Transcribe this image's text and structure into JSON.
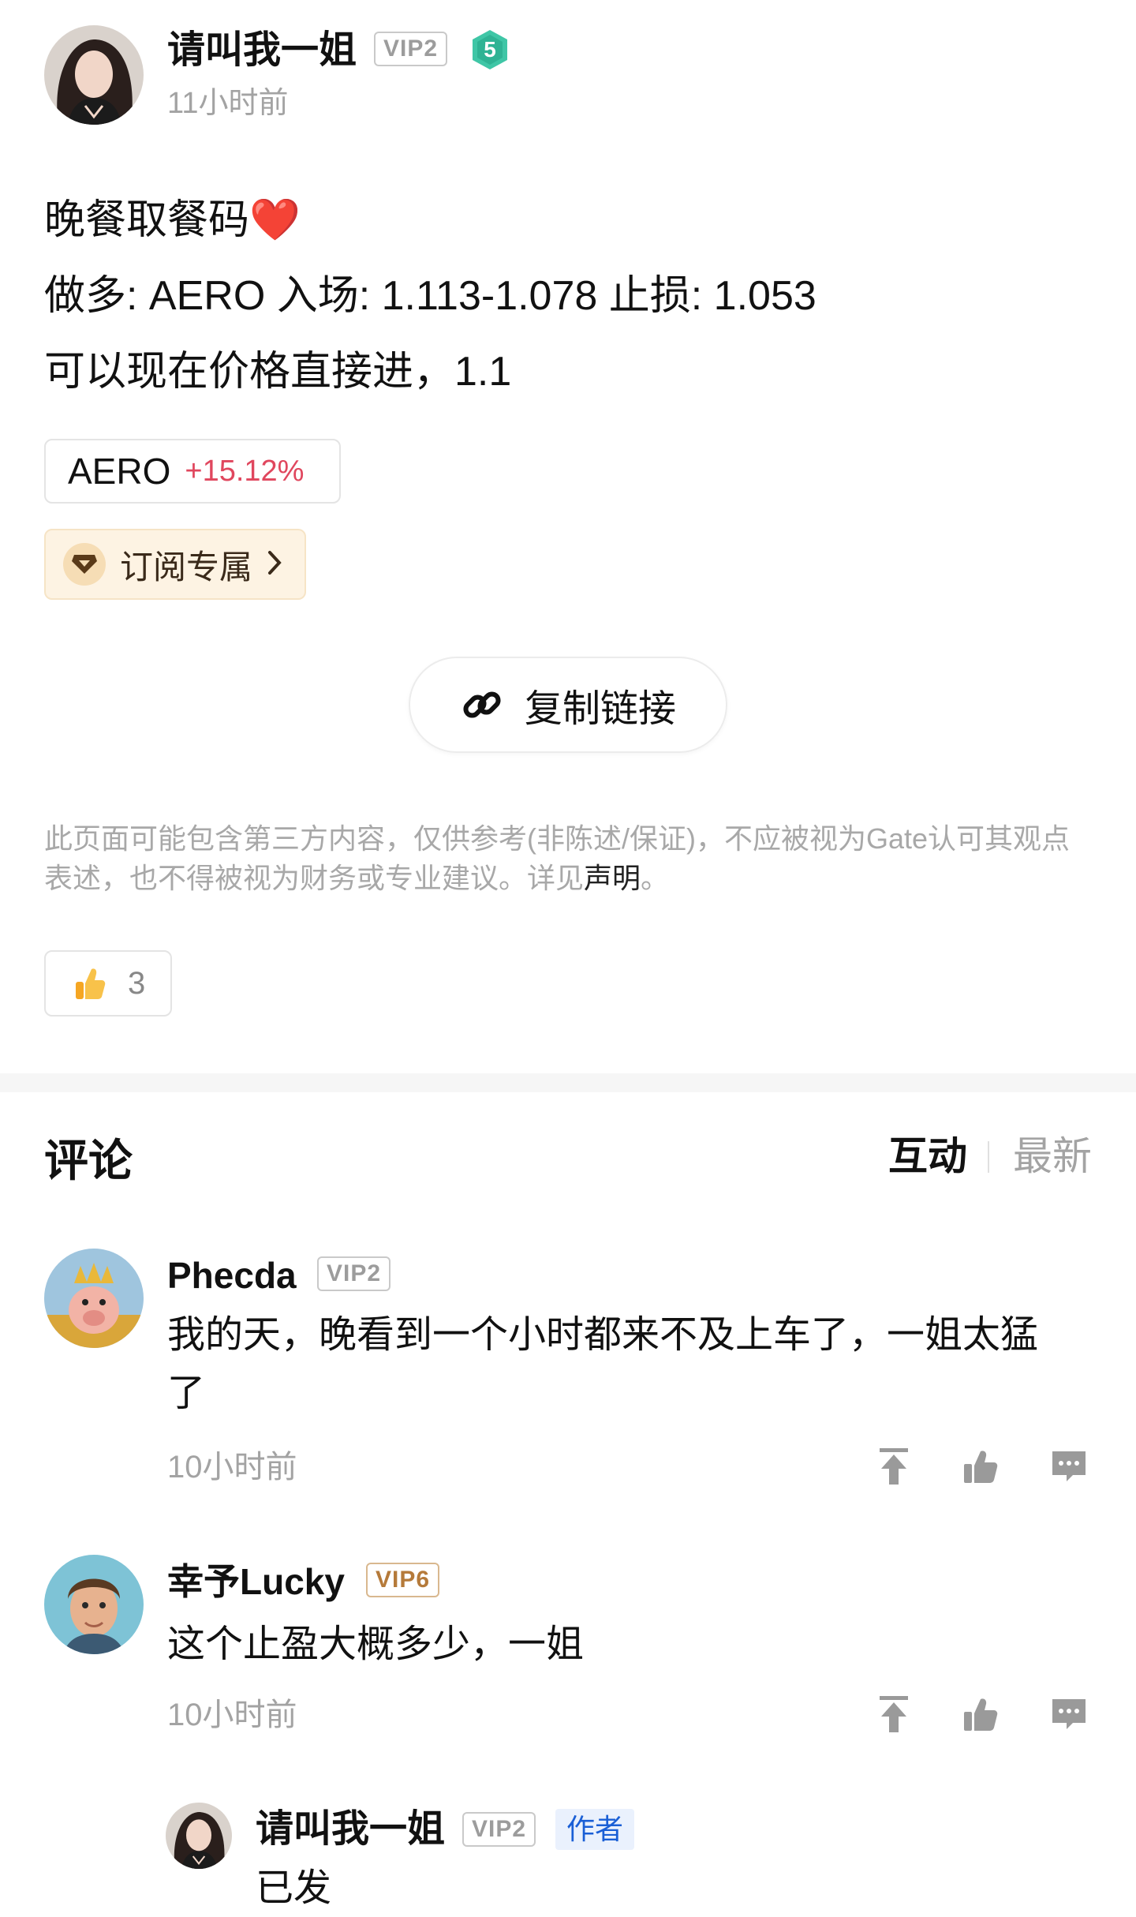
{
  "post": {
    "author": "请叫我一姐",
    "vip": "VIP2",
    "level": "5",
    "time": "11小时前",
    "lines": [
      "晚餐取餐码❤️",
      "做多: AERO 入场: 1.113-1.078 止损: 1.053",
      "可以现在价格直接进，1.1"
    ],
    "ticker": {
      "symbol": "AERO",
      "change": "+15.12%"
    },
    "subscribe_label": "订阅专属",
    "copy_link_label": "复制链接",
    "disclaimer_main": "此页面可能包含第三方内容，仅供参考(非陈述/保证)，不应被视为Gate认可其观点表述，也不得被视为财务或专业建议。详见",
    "disclaimer_link": "声明",
    "disclaimer_end": "。",
    "likes": "3"
  },
  "comments_section": {
    "title": "评论",
    "sort_interactive": "互动",
    "sort_latest": "最新"
  },
  "comments": [
    {
      "user": "Phecda",
      "vip": "VIP2",
      "text_line1": "我的天，晚看到一个小时都来不及上车了，一姐太猛",
      "text_line2": "了",
      "time": "10小时前"
    },
    {
      "user": "幸予Lucky",
      "vip": "VIP6",
      "text": "这个止盈大概多少，一姐",
      "time": "10小时前"
    }
  ],
  "reply": {
    "user": "请叫我一姐",
    "vip": "VIP2",
    "author_badge": "作者",
    "text": "已发"
  },
  "colors": {
    "positive": "#e0475e",
    "link": "#1a5fd6",
    "level_badge": "#3fc6a6",
    "subscribe_bg": "#fdf3e3"
  }
}
